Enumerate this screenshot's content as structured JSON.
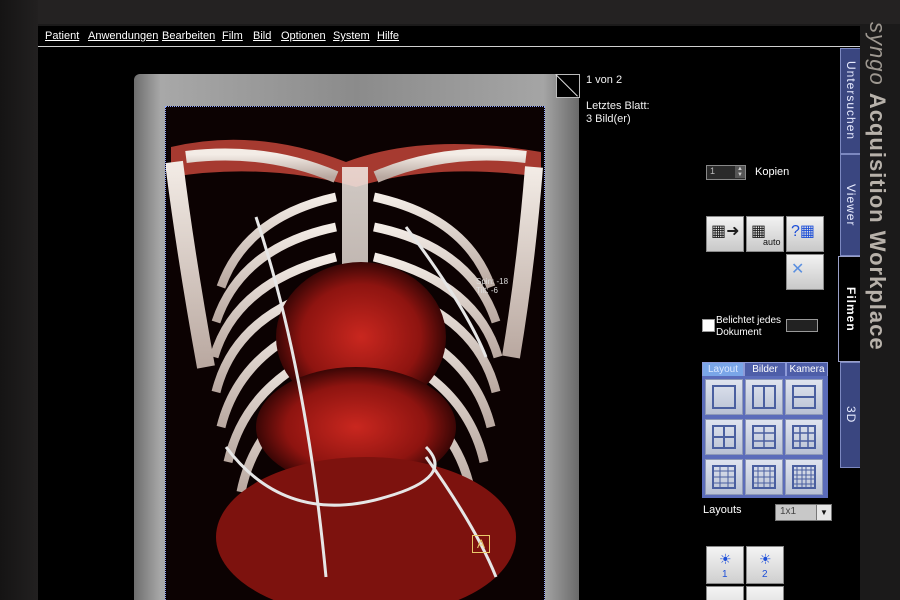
{
  "brand": {
    "word1": "syngo",
    "word2": "Acquisition Workplace"
  },
  "menu": [
    "Patient",
    "Anwendungen",
    "Bearbeiten",
    "Film",
    "Bild",
    "Optionen",
    "System",
    "Hilfe"
  ],
  "film_area": {
    "page": "1 von 2",
    "sheet_label": "Letztes Blatt:",
    "sheet_count": "3 Bild(er)",
    "overlay_line1": "Spin: -18",
    "overlay_line2": "Tilt: -6",
    "marker": "A"
  },
  "copies": {
    "value": "1",
    "label": "Kopien"
  },
  "tool_buttons": [
    {
      "icon": "film-send-icon"
    },
    {
      "icon": "film-auto-icon",
      "sub": "auto"
    },
    {
      "icon": "film-help-icon"
    },
    {
      "icon": "film-delete-icon"
    }
  ],
  "expose": {
    "label_line1": "Belichtet jedes",
    "label_line2": "Dokument"
  },
  "layout_tabs": [
    "Layout",
    "Bilder",
    "Kamera"
  ],
  "layouts": {
    "label": "Layouts",
    "value": "1x1"
  },
  "light_buttons": [
    "1",
    "2"
  ],
  "side_tabs": [
    "Untersuchen",
    "Viewer",
    "Filmen",
    "3D"
  ],
  "colors": {
    "tab_blue": "#3a4680",
    "accent_blue": "#1d4fd8"
  }
}
